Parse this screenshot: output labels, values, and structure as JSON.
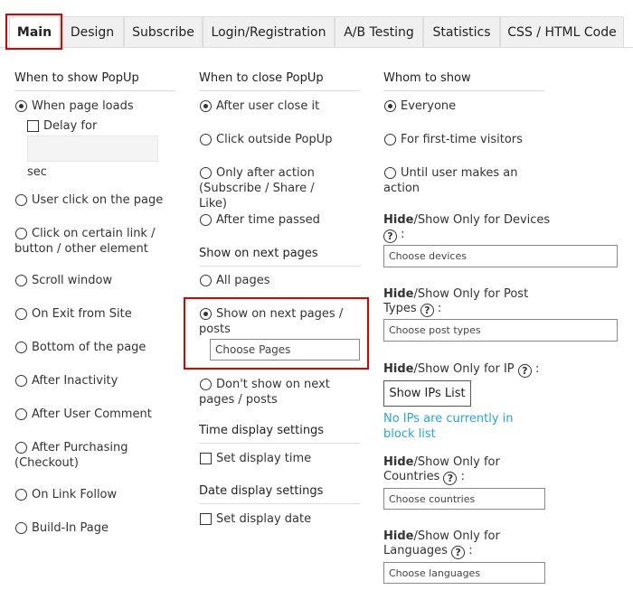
{
  "tabs": [
    "Main",
    "Design",
    "Subscribe",
    "Login/Registration",
    "A/B Testing",
    "Statistics",
    "CSS / HTML Code"
  ],
  "col1": {
    "heading": "When to show PopUp",
    "when_page_loads": "When page loads",
    "delay_for": "Delay for",
    "sec": "sec",
    "options": [
      "User click on the page",
      "Click on certain link / button / other element",
      "Scroll window",
      "On Exit from Site",
      "Bottom of the page",
      "After Inactivity",
      "After User Comment",
      "After Purchasing (Checkout)",
      "On Link Follow",
      "Build-In Page"
    ]
  },
  "col2": {
    "heading": "When to close PopUp",
    "close_options": [
      "After user close it",
      "Click outside PopUp",
      "Only after action (Subscribe / Share / Like)",
      "After time passed"
    ],
    "next_pages_heading": "Show on next pages",
    "all_pages": "All pages",
    "show_on_next": "Show on next pages / posts",
    "choose_pages": "Choose Pages",
    "dont_show": "Don't show on next pages / posts",
    "time_heading": "Time display settings",
    "set_time": "Set display time",
    "date_heading": "Date display settings",
    "set_date": "Set display date"
  },
  "col3": {
    "heading": "Whom to show",
    "whom_options": [
      "Everyone",
      "For first-time visitors",
      "Until user makes an action"
    ],
    "hide": "Hide",
    "devices_label": "/Show Only for Devices",
    "devices_placeholder": "Choose devices",
    "post_label_1": "/Show Only for Post",
    "post_label_2": "Types",
    "post_placeholder": "Choose post types",
    "ip_label": "/Show Only for IP",
    "ip_button": "Show IPs List",
    "ip_note": "No IPs are currently in block list",
    "countries_label_1": "/Show Only for",
    "countries_label_2": "Countries",
    "countries_placeholder": "Choose countries",
    "languages_label_1": "/Show Only for",
    "languages_label_2": "Languages",
    "languages_placeholder": "Choose languages",
    "help_glyph": "?",
    "colon": ":"
  },
  "colors": {
    "highlight": "#e00000",
    "link": "#2aa3d8"
  }
}
